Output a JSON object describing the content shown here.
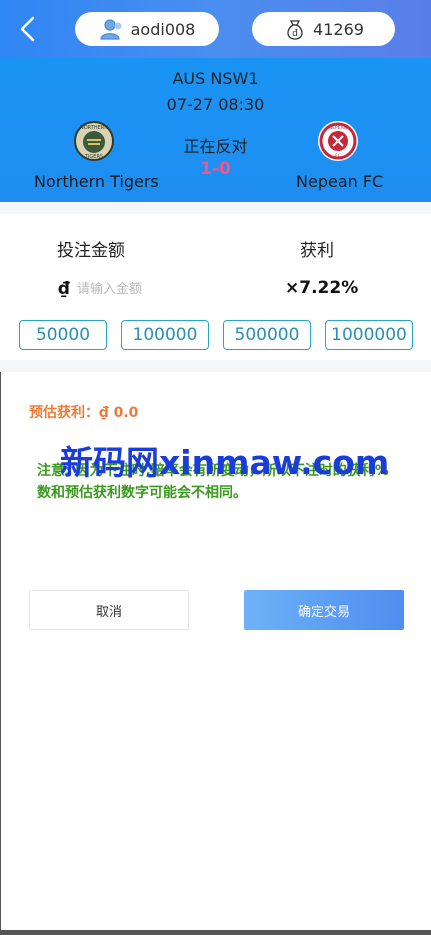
{
  "header": {
    "username": "aodi008",
    "balance": "41269",
    "icons": [
      "chevron-left-icon",
      "user-icon",
      "money-bag-icon"
    ]
  },
  "match": {
    "league": "AUS NSW1",
    "datetime": "07-27 08:30",
    "status": "正在反对",
    "score": "1-0",
    "home_team": "Northern Tigers",
    "away_team": "Nepean FC",
    "home_logo_text": "NORTHERN TIGERS",
    "away_logo_text": "NEPEAN FC"
  },
  "bet": {
    "amount_label": "投注金额",
    "profit_label": "获利",
    "currency_symbol": "₫",
    "amount_placeholder": "请输入金额",
    "odds": "×7.22%",
    "quick_amounts": [
      "50000",
      "100000",
      "500000",
      "1000000"
    ]
  },
  "estimate": {
    "label": "预估获利：",
    "currency_symbol": "₫",
    "value": "0.0"
  },
  "watermark": "新码网xinmaw.com",
  "note": "注意: 因为下注时,赔率会有所变动，所以下注时的获利%数和预估获利数字可能会不相同。",
  "buttons": {
    "cancel": "取消",
    "confirm": "确定交易"
  },
  "colors": {
    "header_gradient_start": "#2f86f5",
    "match_bg": "#1a94f4",
    "score": "#f0568a",
    "chip_border": "#2aa3c8",
    "estimate": "#ee7a3a",
    "note": "#3a9a1e",
    "confirm_button": "#4f8def"
  }
}
